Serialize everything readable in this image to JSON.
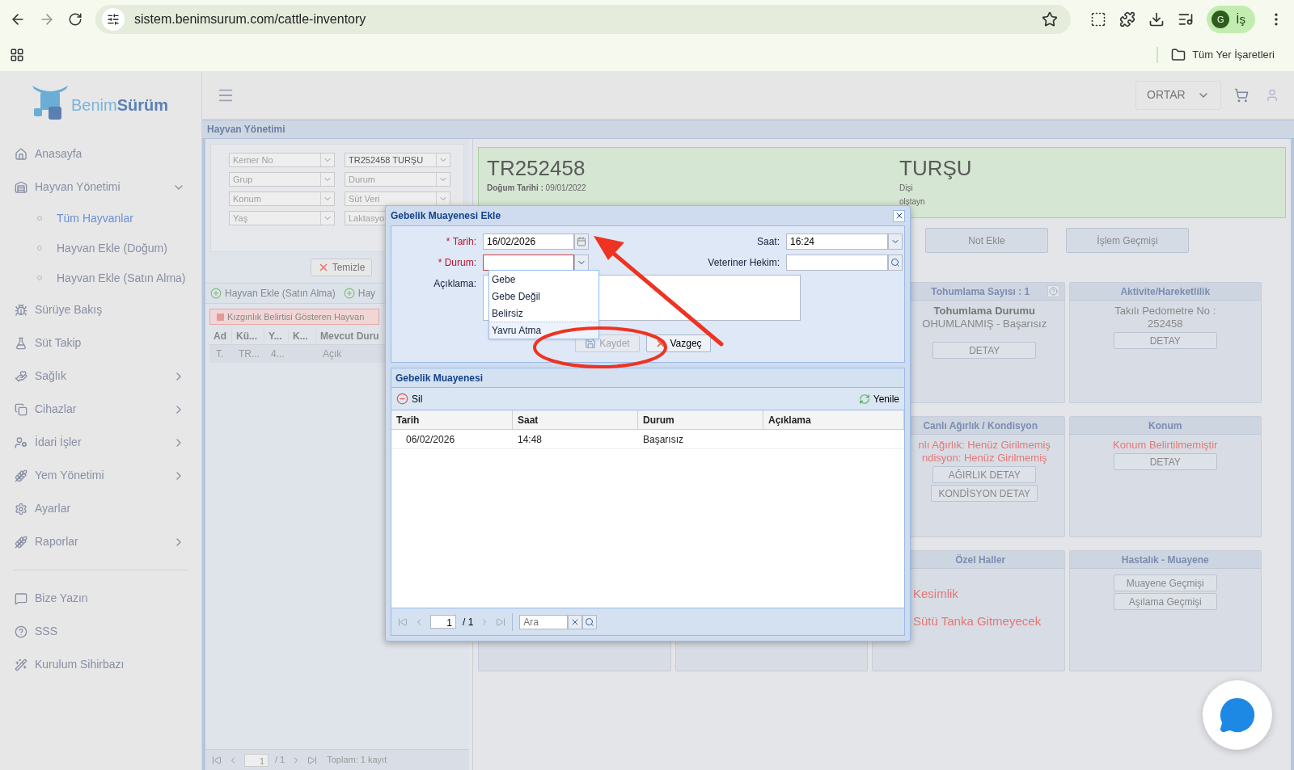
{
  "browser": {
    "url": "sistem.benimsurum.com/cattle-inventory",
    "profile_initial": "G",
    "profile_label": "İş",
    "bookmarks_label": "Tüm Yer İşaretleri"
  },
  "app": {
    "logo_first": "Benim",
    "logo_second": "Sürüm",
    "account": "ORTAR"
  },
  "sidebar": {
    "items": [
      {
        "label": "Anasayfa"
      },
      {
        "label": "Hayvan Yönetimi",
        "expanded": true,
        "children": [
          {
            "label": "Tüm Hayvanlar",
            "selected": true
          },
          {
            "label": "Hayvan Ekle (Doğum)",
            "selected": false
          },
          {
            "label": "Hayvan Ekle (Satın Alma)",
            "selected": false
          }
        ]
      },
      {
        "label": "Sürüye Bakış"
      },
      {
        "label": "Süt Takip"
      },
      {
        "label": "Sağlık",
        "expanded": false
      },
      {
        "label": "Cihazlar",
        "expanded": false
      },
      {
        "label": "İdari İşler",
        "expanded": false
      },
      {
        "label": "Yem Yönetimi",
        "expanded": false
      },
      {
        "label": "Ayarlar"
      },
      {
        "label": "Raporlar",
        "expanded": false
      }
    ],
    "footer_items": [
      {
        "label": "Bize Yazın"
      },
      {
        "label": "SSS"
      },
      {
        "label": "Kurulum Sihirbazı"
      }
    ]
  },
  "page_title": "Hayvan Yönetimi",
  "filters": [
    {
      "placeholder": "Kemer No"
    },
    {
      "value": "TR252458 TURŞU"
    },
    {
      "placeholder": "Grup"
    },
    {
      "placeholder": "Durum"
    },
    {
      "placeholder": "Konum"
    },
    {
      "placeholder": "Süt Veri"
    },
    {
      "placeholder": "Yaş"
    },
    {
      "placeholder": "Laktasyo"
    }
  ],
  "clear_button": "Temizle",
  "toolbar": [
    "Hayvan Ekle (Satın Alma)",
    "Hay"
  ],
  "legend": "Kızgınlık Belirtisi Gösteren Hayvan",
  "animal_table": {
    "columns": [
      "Ad",
      "Kü...",
      "Y...",
      "K...",
      "Mevcut Duru"
    ],
    "rows": [
      [
        "T.",
        "TR...",
        "4...",
        null,
        "Açık"
      ]
    ]
  },
  "pager": {
    "page": "1",
    "total_pages": "/ 1",
    "summary": "Toplam: 1 kayıt"
  },
  "animal_card": {
    "id": "TR252458",
    "birth_label": "Doğum Tarihi :",
    "birth_date": "09/01/2022",
    "name": "TURŞU",
    "sex": "Dişi",
    "breed": "olştayn"
  },
  "actions": [
    "Not Ekle",
    "İşlem Geçmişi"
  ],
  "cards": [
    {
      "title": "Tohumlama Sayısı : 1",
      "help": true,
      "lines": [
        {
          "kind": "bold",
          "text": "Tohumlama Durumu"
        },
        {
          "kind": "plain",
          "text": "OHUMLANMIŞ - Başarısız"
        }
      ],
      "buttons": [
        "DETAY"
      ]
    },
    {
      "title": "Aktivite/Hareketlilik",
      "lines": [
        {
          "kind": "plain",
          "text": "Takılı Pedometre No :"
        },
        {
          "kind": "plain",
          "text": "252458"
        }
      ],
      "buttons": [
        "DETAY"
      ]
    },
    {
      "title": "Canlı Ağırlık / Kondisyon",
      "lines": [
        {
          "kind": "warning",
          "text": "nlı Ağırlık: Henüz Girilmemiş"
        },
        {
          "kind": "warning",
          "text": "ndisyon: Henüz Girilmemiş"
        }
      ],
      "buttons": [
        "AĞIRLIK DETAY",
        "KONDİSYON DETAY"
      ]
    },
    {
      "title": "Konum",
      "lines": [
        {
          "kind": "warning",
          "text": "Konum Belirtilmemiştir"
        }
      ],
      "buttons": [
        "DETAY"
      ]
    },
    {
      "title": "Özel Haller",
      "lines": [
        {
          "kind": "flag",
          "text": "Kesimlik"
        },
        {
          "kind": "flag",
          "text": "Sütü Tanka Gitmeyecek"
        }
      ]
    },
    {
      "title": "Hastalık - Muayene",
      "buttons": [
        "Muayene Geçmişi",
        "Aşılama Geçmişi"
      ]
    }
  ],
  "dialog": {
    "title": "Gebelik Muayenesi Ekle",
    "fields": [
      {
        "kind": "date",
        "label": "* Tarih:",
        "required": true,
        "invalid": false,
        "value": "16/02/2026"
      },
      {
        "kind": "select",
        "label": "Saat:",
        "required": false,
        "invalid": false,
        "value": "16:24"
      },
      {
        "kind": "select",
        "label": "* Durum:",
        "required": true,
        "invalid": true
      },
      {
        "kind": "lookup",
        "label": "Veteriner Hekim:",
        "required": false,
        "invalid": false
      },
      {
        "kind": "textarea",
        "label": "Açıklama:",
        "required": false
      }
    ],
    "dropdown_options": [
      {
        "label": "Gebe",
        "selected": false
      },
      {
        "label": "Gebe Değil",
        "selected": false
      },
      {
        "label": "Belirsiz",
        "selected": false
      },
      {
        "label": "Yavru Atma",
        "selected": true
      }
    ],
    "buttons": [
      {
        "label": "Kaydet",
        "disabled": true
      },
      {
        "label": "Vazgeç",
        "disabled": false
      }
    ],
    "history": {
      "title": "Gebelik Muayenesi",
      "delete": "Sil",
      "refresh": "Yenile",
      "columns": [
        "Tarih",
        "Saat",
        "Durum",
        "Açıklama"
      ],
      "rows": [
        [
          "06/02/2026",
          "14:48",
          "Başarısız"
        ]
      ],
      "page": "1",
      "total_pages": "/ 1",
      "search_placeholder": "Ara"
    }
  }
}
